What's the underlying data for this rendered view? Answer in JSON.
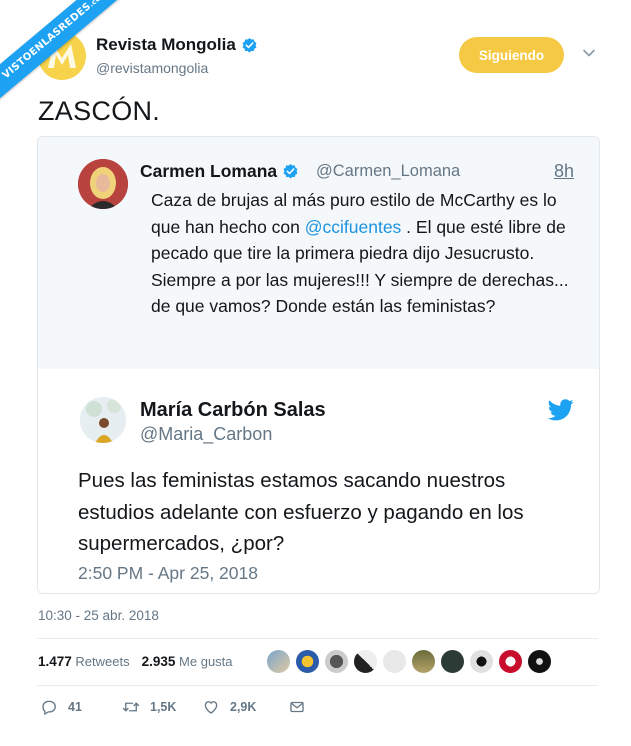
{
  "watermark": {
    "text": "VISTOENLASREDES",
    "suffix": ".com"
  },
  "account": {
    "name": "Revista Mongolia",
    "handle": "@revistamongolia",
    "follow_label": "Siguiendo"
  },
  "tweet": {
    "text": "ZASCÓN.",
    "timestamp": "10:30 - 25 abr. 2018"
  },
  "quoted": {
    "name": "Carmen Lomana",
    "handle": "@Carmen_Lomana",
    "time": "8h",
    "text_before": "Caza  de brujas al más puro estilo de McCarthy es lo que han hecho con ",
    "mention": "@ccifuentes",
    "text_after": " . El que esté libre de pecado que tire la primera piedra dijo Jesucrusto. Siempre a por las mujeres!!! Y siempre de derechas... de que vamos? Donde están las feministas?"
  },
  "embedded": {
    "name": "María Carbón Salas",
    "handle": "@Maria_Carbon",
    "text": "Pues las feministas estamos sacando nuestros estudios adelante con esfuerzo y pagando en los supermercados, ¿por?",
    "time": "2:50 PM - Apr 25, 2018"
  },
  "stats": {
    "retweets_count": "1.477",
    "retweets_label": "Retweets",
    "likes_count": "2.935",
    "likes_label": "Me gusta"
  },
  "actions": {
    "reply_count": "41",
    "retweet_count": "1,5K",
    "like_count": "2,9K"
  },
  "colors": {
    "accent": "#1da1f2",
    "follow": "#f6c944",
    "mention": "#1b95e0",
    "muted": "#657786"
  },
  "icons": [
    "verified-icon",
    "chevron-down-icon",
    "twitter-bird-icon",
    "reply-icon",
    "retweet-icon",
    "heart-icon",
    "mail-icon"
  ]
}
